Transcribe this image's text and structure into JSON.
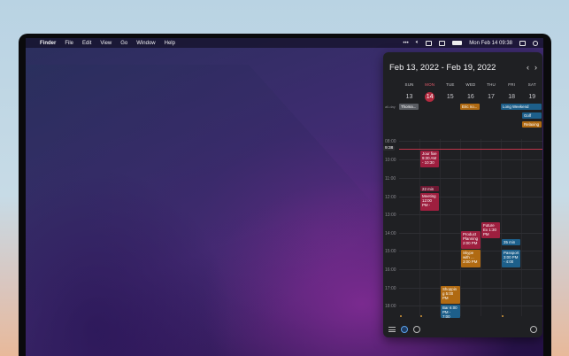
{
  "menubar": {
    "apple": "",
    "app": "Finder",
    "items": [
      "File",
      "Edit",
      "View",
      "Go",
      "Window",
      "Help"
    ],
    "more": "•••",
    "datetime": "Mon Feb 14 09:38"
  },
  "calendar": {
    "title": "Feb 13, 2022 - Feb 19, 2022",
    "prev": "‹",
    "next": "›",
    "days": [
      {
        "name": "SUN",
        "num": "13"
      },
      {
        "name": "MON",
        "num": "14"
      },
      {
        "name": "TUE",
        "num": "15"
      },
      {
        "name": "WED",
        "num": "16"
      },
      {
        "name": "THU",
        "num": "17"
      },
      {
        "name": "FRI",
        "num": "18"
      },
      {
        "name": "SAT",
        "num": "19"
      }
    ],
    "allday_label": "all-day",
    "allday_events": {
      "thomas": "Thoma...",
      "eric": "Eric no...",
      "long_weekend": "Long Weekend",
      "golf": "Golf",
      "relaxing": "Relaxing"
    },
    "hours": {
      "h08": "08:00",
      "h10": "10:00",
      "h11": "11:00",
      "h12": "12:00",
      "h13": "13:00",
      "h14": "14:00",
      "h15": "15:00",
      "h16": "16:00",
      "h17": "17:00",
      "h18": "18:00"
    },
    "now": "9:38",
    "events": {
      "jour_fixe": "Jour fixe 9:30 AM - 10:30",
      "mins22": "22 min",
      "meeting": "Meeting 12:00 PM -",
      "future_ex": "Future Ex 1:30 PM",
      "product_planning": "Product Planning 2:00 PM",
      "mins35": "35 min",
      "skype": "Skype with ... 3:00 PM",
      "passport": "Passport 3:00 PM - 4:00",
      "shopping": "Shoppin g 5:00 PM",
      "bar": "Bar 6:00 PM - 7:00"
    },
    "colors": {
      "red": "#9e1f3f",
      "orange": "#b06a12",
      "blue": "#1d5f8a",
      "today": "#b42a3f"
    }
  }
}
